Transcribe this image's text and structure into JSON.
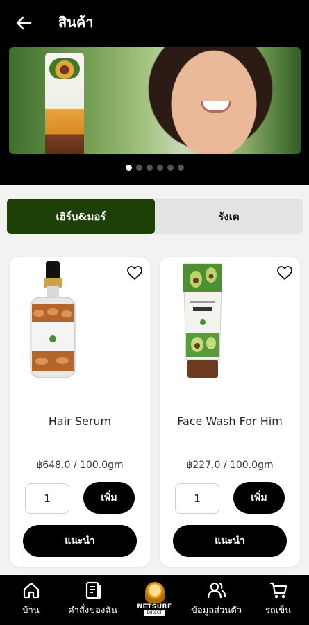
{
  "header": {
    "title": "สินค้า",
    "back_icon": "arrow-left-icon"
  },
  "banner": {
    "slides_total": 6,
    "active_slide": 1
  },
  "category_tabs": [
    {
      "label": "เฮิร์บ&มอร์",
      "active": true
    },
    {
      "label": "รังเต",
      "active": false
    }
  ],
  "products": [
    {
      "name": "Hair Serum",
      "price": "฿648.0 / 100.0gm",
      "quantity": "1",
      "add_label": "เพิ่ม",
      "recommend_label": "แนะนำ",
      "favorite_icon": "heart-outline-icon"
    },
    {
      "name": "Face Wash For Him",
      "price": "฿227.0 / 100.0gm",
      "quantity": "1",
      "add_label": "เพิ่ม",
      "recommend_label": "แนะนำ",
      "favorite_icon": "heart-outline-icon"
    }
  ],
  "bottom_nav": {
    "items": [
      {
        "label": "บ้าน",
        "icon": "home-icon"
      },
      {
        "label": "คำสั่งของฉัน",
        "icon": "document-icon"
      },
      {
        "label": "NETSURF",
        "sublabel": "DIRECT",
        "icon": "netsurf-logo"
      },
      {
        "label": "ข้อมูลส่วนตัว",
        "icon": "users-icon"
      },
      {
        "label": "รถเข็น",
        "icon": "cart-icon"
      }
    ]
  },
  "colors": {
    "accent": "#1c4006",
    "header_bg": "#000000",
    "button_bg": "#000000"
  }
}
